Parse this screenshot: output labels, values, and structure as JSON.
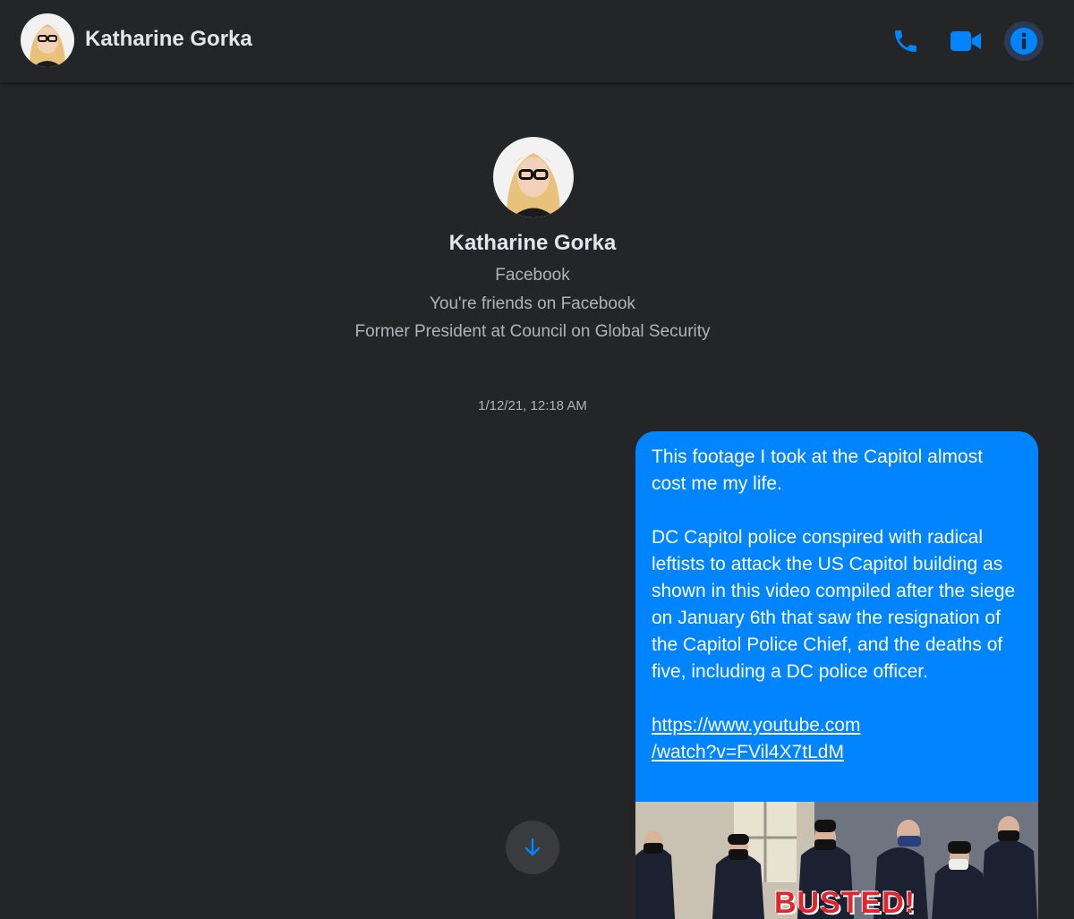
{
  "header": {
    "contact_name": "Katharine Gorka",
    "icons": [
      "phone-icon",
      "video-camera-icon",
      "info-icon"
    ]
  },
  "profile": {
    "name": "Katharine Gorka",
    "platform": "Facebook",
    "relationship": "You're friends on Facebook",
    "work": "Former President at Council on Global Security"
  },
  "conversation": {
    "timestamp": "1/12/21, 12:18 AM",
    "message": {
      "para1": "This footage I took at the Capitol almost cost me my life.",
      "para2": "DC Capitol police conspired with radical leftists to attack the US Capitol building as shown in this video compiled after the siege on January 6th that saw the resignation of the Capitol Police Chief, and the deaths of five, including a DC police officer.",
      "link_line1": "https://www.youtube.com",
      "link_line2": "/watch?v=FVil4X7tLdM",
      "thumbnail_caption": "BUSTED!"
    }
  },
  "colors": {
    "background": "#242526",
    "accent": "#0084ff",
    "bubble": "#0084ff",
    "text_primary": "#e4e6eb",
    "text_secondary": "#b0b3b8"
  }
}
